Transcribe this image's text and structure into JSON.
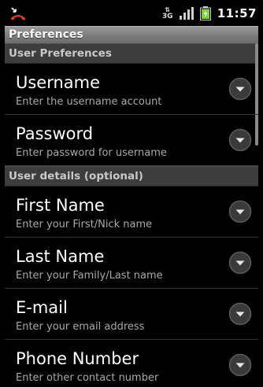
{
  "status_bar": {
    "network_type": "3G",
    "time": "11:57",
    "icons": [
      "missed-call-icon",
      "network-3g-icon",
      "signal-icon",
      "battery-charging-icon"
    ]
  },
  "title": "Preferences",
  "sections": [
    {
      "header": "User Preferences",
      "items": [
        {
          "title": "Username",
          "summary": "Enter the username account"
        },
        {
          "title": "Password",
          "summary": "Enter password for username"
        }
      ]
    },
    {
      "header": "User details (optional)",
      "items": [
        {
          "title": "First Name",
          "summary": "Enter your First/Nick name"
        },
        {
          "title": "Last Name",
          "summary": "Enter your Family/Last name"
        },
        {
          "title": "E-mail",
          "summary": "Enter your email address"
        },
        {
          "title": "Phone Number",
          "summary": "Enter other contact number"
        }
      ]
    }
  ],
  "colors": {
    "background": "#000000",
    "category_bg": "#3d3d3d",
    "title_bar": "#8a8a8a",
    "summary_text": "#a8a8a8",
    "battery_green": "#7fd13b"
  }
}
